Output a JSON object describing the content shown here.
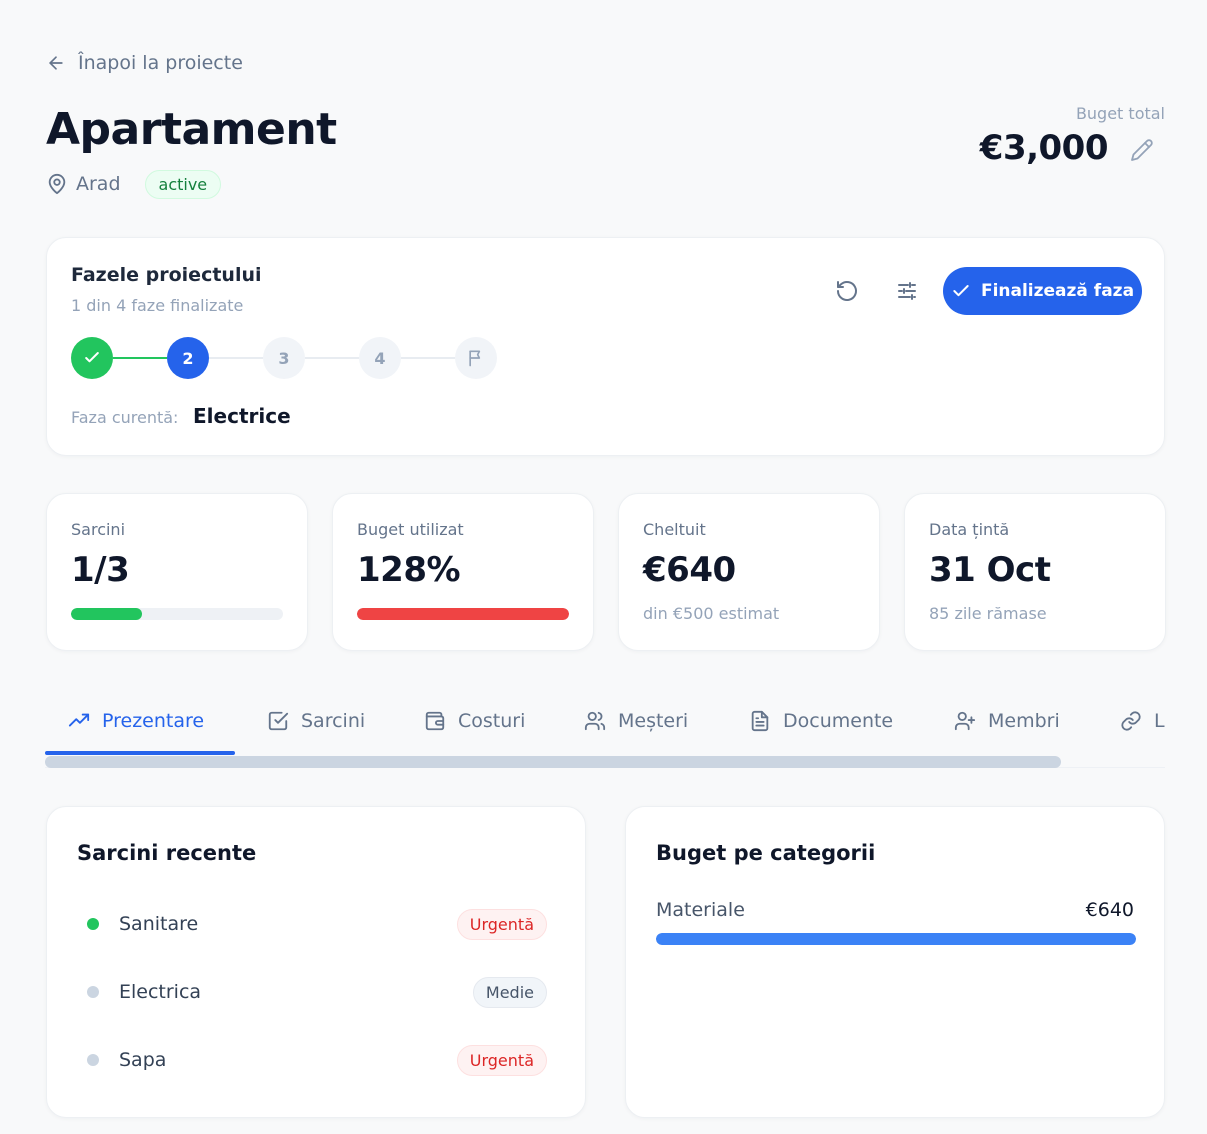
{
  "back_link": {
    "label": "Înapoi la proiecte",
    "icon": "arrow-left-icon"
  },
  "project": {
    "title": "Apartament",
    "location": "Arad",
    "status": "active",
    "budget_label": "Buget total",
    "budget_value": "€3,000"
  },
  "phases": {
    "title": "Fazele proiectului",
    "subtitle": "1 din 4 faze finalizate",
    "finish_button": "Finalizează faza",
    "steps": [
      {
        "label": "",
        "state": "done",
        "icon": "check-icon"
      },
      {
        "label": "2",
        "state": "current"
      },
      {
        "label": "3",
        "state": "todo"
      },
      {
        "label": "4",
        "state": "todo"
      },
      {
        "label": "",
        "state": "todo",
        "icon": "flag-icon"
      }
    ],
    "current_label": "Faza curentă:",
    "current_value": "Electrice"
  },
  "stats": [
    {
      "label": "Sarcini",
      "value": "1/3",
      "progress": 0.333,
      "color": "#22c55e"
    },
    {
      "label": "Buget utilizat",
      "value": "128%",
      "progress": 1.0,
      "color": "#ef4444"
    },
    {
      "label": "Cheltuit",
      "value": "€640",
      "sub": "din €500 estimat"
    },
    {
      "label": "Data țintă",
      "value": "31 Oct",
      "sub": "85 zile rămase"
    }
  ],
  "tabs": [
    {
      "label": "Prezentare",
      "icon": "trending-up-icon",
      "active": true
    },
    {
      "label": "Sarcini",
      "icon": "checkbox-icon"
    },
    {
      "label": "Costuri",
      "icon": "wallet-icon"
    },
    {
      "label": "Meșteri",
      "icon": "users-icon"
    },
    {
      "label": "Documente",
      "icon": "document-icon"
    },
    {
      "label": "Membri",
      "icon": "user-plus-icon"
    },
    {
      "label": "L",
      "icon": "link-icon"
    }
  ],
  "recent_tasks": {
    "title": "Sarcini recente",
    "items": [
      {
        "name": "Sanitare",
        "priority": "Urgentă",
        "dot_color": "#22c55e"
      },
      {
        "name": "Electrica",
        "priority": "Medie",
        "dot_color": "#cbd5e1"
      },
      {
        "name": "Sapa",
        "priority": "Urgentă",
        "dot_color": "#cbd5e1"
      }
    ]
  },
  "budget_by_category": {
    "title": "Buget pe categorii",
    "items": [
      {
        "name": "Materiale",
        "value": "€640",
        "fraction": 1.0
      }
    ]
  },
  "colors": {
    "primary": "#2563eb",
    "success": "#22c55e",
    "danger": "#ef4444"
  }
}
